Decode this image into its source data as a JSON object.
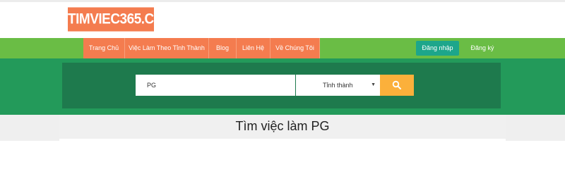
{
  "logo": {
    "text": "TIMVIEC365.COM"
  },
  "nav": {
    "items": [
      {
        "label": "Trang Chủ"
      },
      {
        "label": "Việc Làm Theo Tỉnh Thành"
      },
      {
        "label": "Blog"
      },
      {
        "label": "Liên Hệ"
      },
      {
        "label": "Về Chúng Tôi"
      }
    ],
    "login_label": "Đăng nhập",
    "register_label": "Đăng ký"
  },
  "search": {
    "query": "PG",
    "province_label": "Tỉnh thành",
    "caret_icon": "▼",
    "button_icon": "search-icon"
  },
  "page": {
    "title": "Tìm việc làm PG"
  },
  "colors": {
    "brand_orange": "#f47c4f",
    "nav_green": "#6abd45",
    "hero_green": "#239a5a",
    "hero_inner": "#1e7a4d",
    "login_teal": "#1da68b",
    "search_yellow": "#fbb03b"
  }
}
